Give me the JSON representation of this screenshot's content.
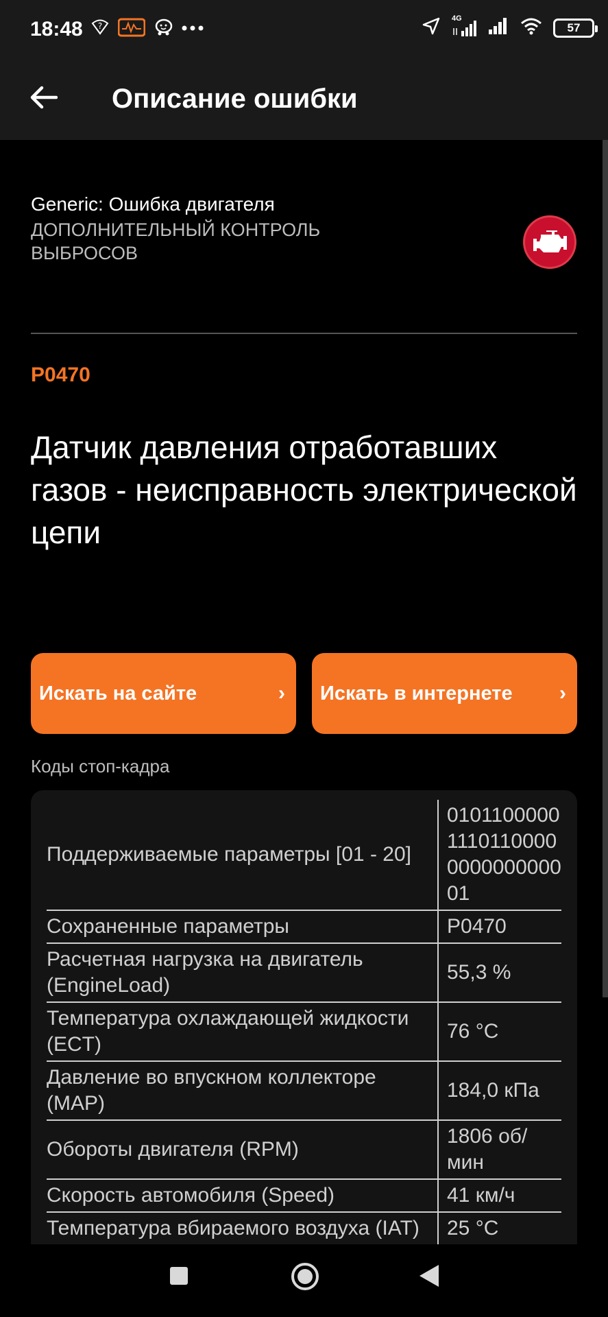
{
  "status_bar": {
    "time": "18:48",
    "network_label": "4G",
    "battery": "57",
    "left_icons": [
      "wifi-question-icon",
      "obd-app-icon",
      "waze-icon",
      "more-dots-icon"
    ],
    "right_icons": [
      "location-arrow-icon",
      "signal-4g-icon",
      "signal-icon",
      "wifi-icon",
      "battery-icon"
    ]
  },
  "app_bar": {
    "title": "Описание ошибки",
    "back_icon": "arrow-left-icon"
  },
  "error": {
    "category": "Generic: Ошибка двигателя",
    "subcategory": "ДОПОЛНИТЕЛЬНЫЙ КОНТРОЛЬ ВЫБРОСОВ",
    "code": "P0470",
    "title": "Датчик давления отработавших газов - неисправность электрической цепи",
    "icon": "check-engine-icon"
  },
  "buttons": {
    "search_site": "Искать на сайте",
    "search_web": "Искать в интернете",
    "chevron": "›"
  },
  "freeze_frame": {
    "label": "Коды стоп-кадра",
    "rows": [
      {
        "name": "Поддерживаемые параметры [01 - 20]",
        "value": "01011000001110110000000000000001"
      },
      {
        "name": "Сохраненные параметры",
        "value": "P0470"
      },
      {
        "name": "Расчетная нагрузка на двигатель (EngineLoad)",
        "value": "55,3 %"
      },
      {
        "name": "Температура охлаждающей жидкости (ECT)",
        "value": "76 °C"
      },
      {
        "name": "Давление во впускном коллекторе (MAP)",
        "value": "184,0 кПа"
      },
      {
        "name": "Обороты двигателя (RPM)",
        "value": "1806 об/мин"
      },
      {
        "name": "Скорость автомобиля (Speed)",
        "value": "41 км/ч"
      },
      {
        "name": "Температура вбираемого воздуха (IAT)",
        "value": "25 °C"
      }
    ]
  },
  "colors": {
    "accent": "#f47424",
    "background": "#000000",
    "bar": "#1a1a1a",
    "card": "#141414",
    "engine_badge": "#c8102e"
  },
  "nav_bar": {
    "icons": [
      "recent-apps-icon",
      "home-icon",
      "back-icon"
    ]
  }
}
